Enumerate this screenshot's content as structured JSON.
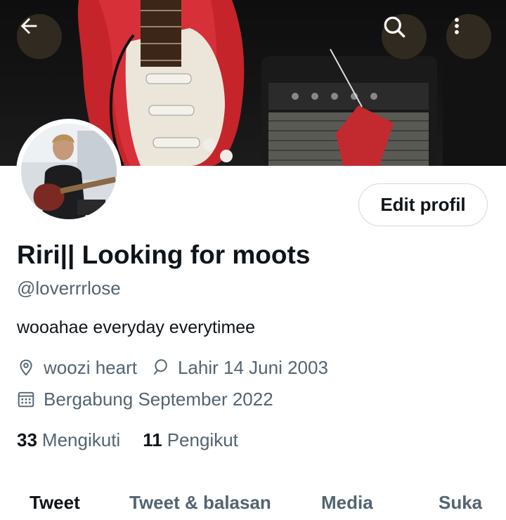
{
  "header": {
    "back_icon": "arrow-left-icon",
    "search_icon": "search-icon",
    "more_icon": "more-vertical-icon"
  },
  "profile": {
    "edit_label": "Edit profil",
    "display_name": "Riri|| Looking for moots",
    "handle": "@loverrrlose",
    "bio": "wooahae everyday everytimee",
    "location": "woozi heart",
    "birthday": "Lahir 14 Juni 2003",
    "joined": "Bergabung September 2022",
    "following_count": "33",
    "following_label": "Mengikuti",
    "followers_count": "11",
    "followers_label": "Pengikut"
  },
  "tabs": [
    {
      "label": "Tweet",
      "active": true
    },
    {
      "label": "Tweet & balasan",
      "active": false
    },
    {
      "label": "Media",
      "active": false
    },
    {
      "label": "Suka",
      "active": false
    }
  ],
  "colors": {
    "text_primary": "#0f1419",
    "text_secondary": "#536471",
    "border": "#cfd9de",
    "header_button_bg": "#342c22"
  }
}
